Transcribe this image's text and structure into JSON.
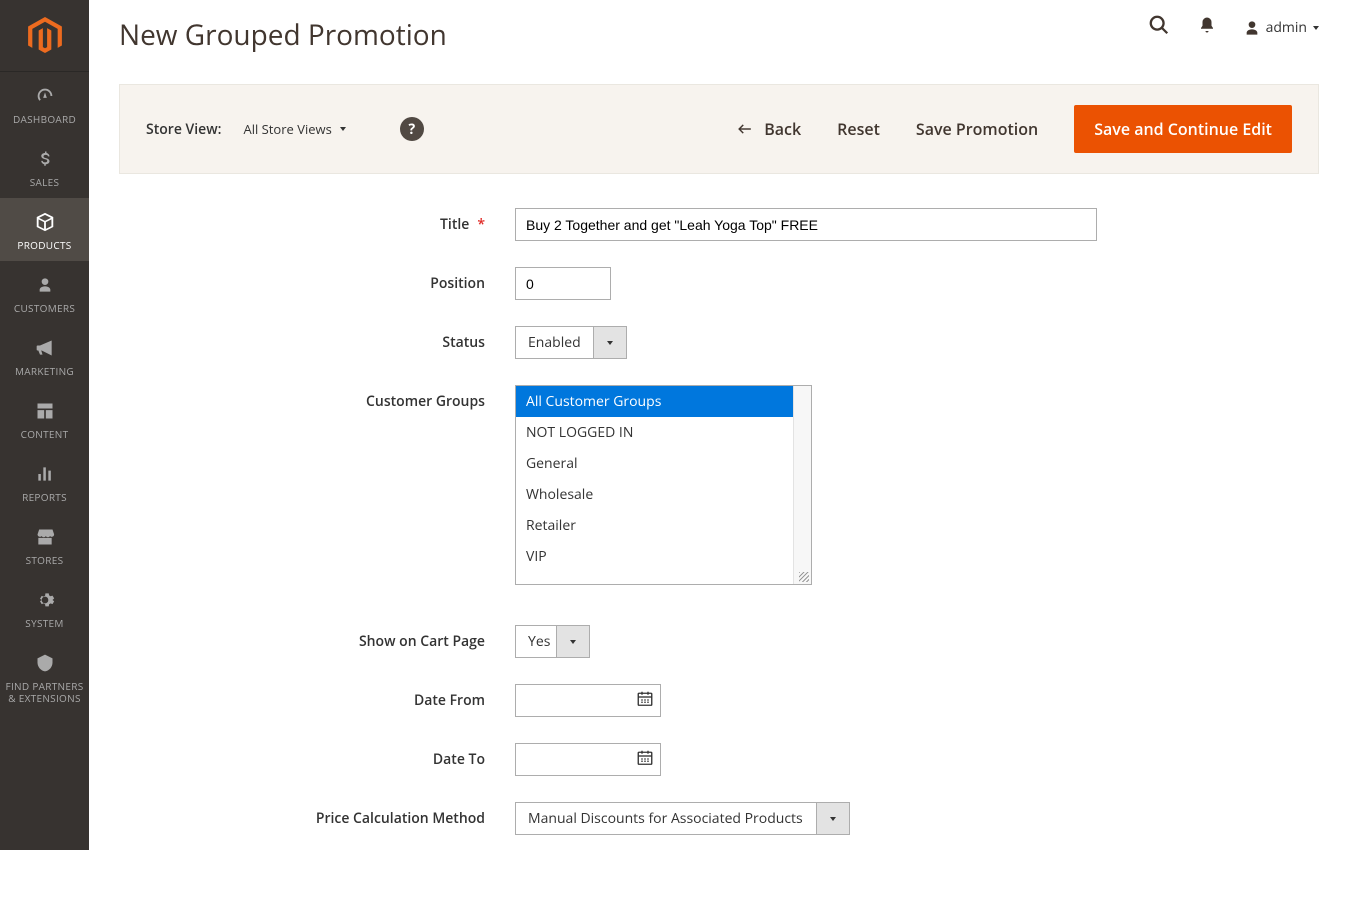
{
  "sidebar": {
    "items": [
      {
        "label": "DASHBOARD"
      },
      {
        "label": "SALES"
      },
      {
        "label": "PRODUCTS"
      },
      {
        "label": "CUSTOMERS"
      },
      {
        "label": "MARKETING"
      },
      {
        "label": "CONTENT"
      },
      {
        "label": "REPORTS"
      },
      {
        "label": "STORES"
      },
      {
        "label": "SYSTEM"
      },
      {
        "label": "FIND PARTNERS\n& EXTENSIONS"
      }
    ]
  },
  "header": {
    "title": "New Grouped Promotion",
    "user": "admin"
  },
  "toolbar": {
    "store_view_label": "Store View:",
    "store_view_value": "All Store Views",
    "back": "Back",
    "reset": "Reset",
    "save": "Save Promotion",
    "save_continue": "Save and Continue Edit"
  },
  "form": {
    "title_label": "Title",
    "title_value": "Buy 2 Together and get \"Leah Yoga Top\" FREE",
    "position_label": "Position",
    "position_value": "0",
    "status_label": "Status",
    "status_value": "Enabled",
    "customer_groups_label": "Customer Groups",
    "customer_groups_options": [
      "All Customer Groups",
      "NOT LOGGED IN",
      "General",
      "Wholesale",
      "Retailer",
      "VIP"
    ],
    "customer_groups_selected": "All Customer Groups",
    "show_cart_label": "Show on Cart Page",
    "show_cart_value": "Yes",
    "date_from_label": "Date From",
    "date_from_value": "",
    "date_to_label": "Date To",
    "date_to_value": "",
    "price_calc_label": "Price Calculation Method",
    "price_calc_value": "Manual Discounts for Associated Products"
  }
}
